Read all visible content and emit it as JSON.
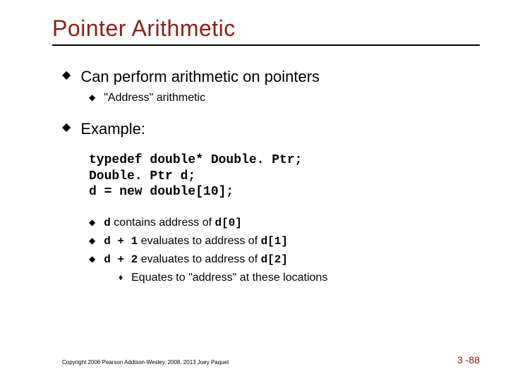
{
  "title": "Pointer Arithmetic",
  "bullets": {
    "b1": "Can perform arithmetic on pointers",
    "b1a": "\"Address\" arithmetic",
    "b2": "Example:"
  },
  "code": {
    "line1": "typedef double* Double. Ptr;",
    "line2": "Double. Ptr d;",
    "line3": "d = new double[10];"
  },
  "sub": {
    "s1_pre": "",
    "s1_code1": "d",
    "s1_mid": " contains address of ",
    "s1_code2": "d[0]",
    "s2_code1": "d + 1",
    "s2_mid": " evaluates to address of ",
    "s2_code2": "d[1]",
    "s3_code1": "d + 2",
    "s3_mid": " evaluates to address of ",
    "s3_code2": "d[2]",
    "s4": "Equates to \"address\" at these locations"
  },
  "footer": {
    "left": "Copyright 2006 Pearson Addison-Wesley, 2008, 2013 Joey Paquet",
    "right": "3 -88"
  }
}
